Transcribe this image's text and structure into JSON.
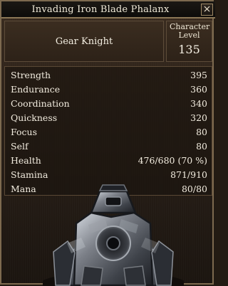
{
  "window": {
    "title": "Invading Iron Blade Phalanx",
    "close_label": "×"
  },
  "character": {
    "name": "Gear Knight",
    "level_label": "Character Level",
    "level": "135"
  },
  "stats": [
    {
      "label": "Strength",
      "value": "395"
    },
    {
      "label": "Endurance",
      "value": "360"
    },
    {
      "label": "Coordination",
      "value": "340"
    },
    {
      "label": "Quickness",
      "value": "320"
    },
    {
      "label": "Focus",
      "value": "80"
    },
    {
      "label": "Self",
      "value": "80"
    },
    {
      "label": "Health",
      "value": "476/680 (70 %)"
    },
    {
      "label": "Stamina",
      "value": "871/910"
    },
    {
      "label": "Mana",
      "value": "80/80"
    }
  ],
  "colors": {
    "background": "#231b13",
    "border": "#7d6a4f",
    "text": "#f1ead8"
  }
}
